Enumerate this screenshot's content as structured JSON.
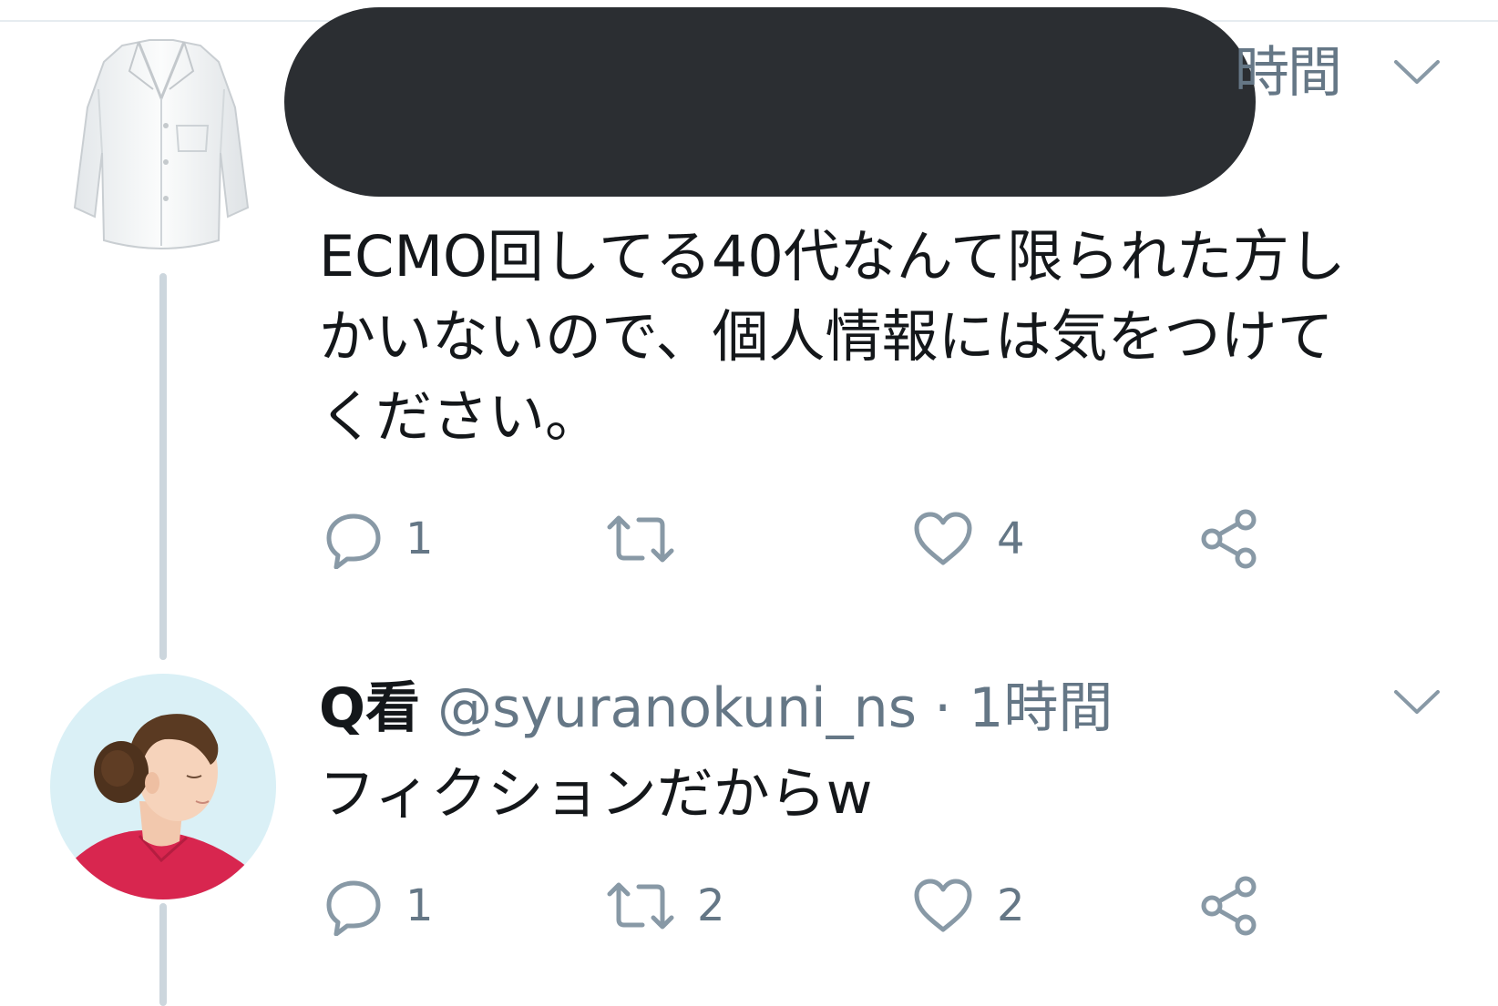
{
  "tweet1": {
    "time_partial": "時間",
    "text_lines": [
      "ECMO回してる40代なんて限られた方し",
      "かいないので、個人情報には気をつけて",
      "ください。"
    ],
    "actions": {
      "reply_count": "1",
      "retweet_count": "",
      "like_count": "4"
    }
  },
  "tweet2": {
    "name": "Q看",
    "handle": "@syuranokuni_ns",
    "separator": "·",
    "time": "1時間",
    "text": "フィクションだからw",
    "actions": {
      "reply_count": "1",
      "retweet_count": "2",
      "like_count": "2"
    }
  },
  "icons": {
    "reply": "reply-icon",
    "retweet": "retweet-icon",
    "like": "heart-icon",
    "share": "share-icon",
    "menu": "chevron-down-icon"
  },
  "colors": {
    "text": "#14171a",
    "secondary": "#657786",
    "thread_line": "#ccd6dd",
    "redaction": "#2b2e32",
    "nurse_avatar_bg": "#daf0f6",
    "scrubs": "#d8264f"
  }
}
